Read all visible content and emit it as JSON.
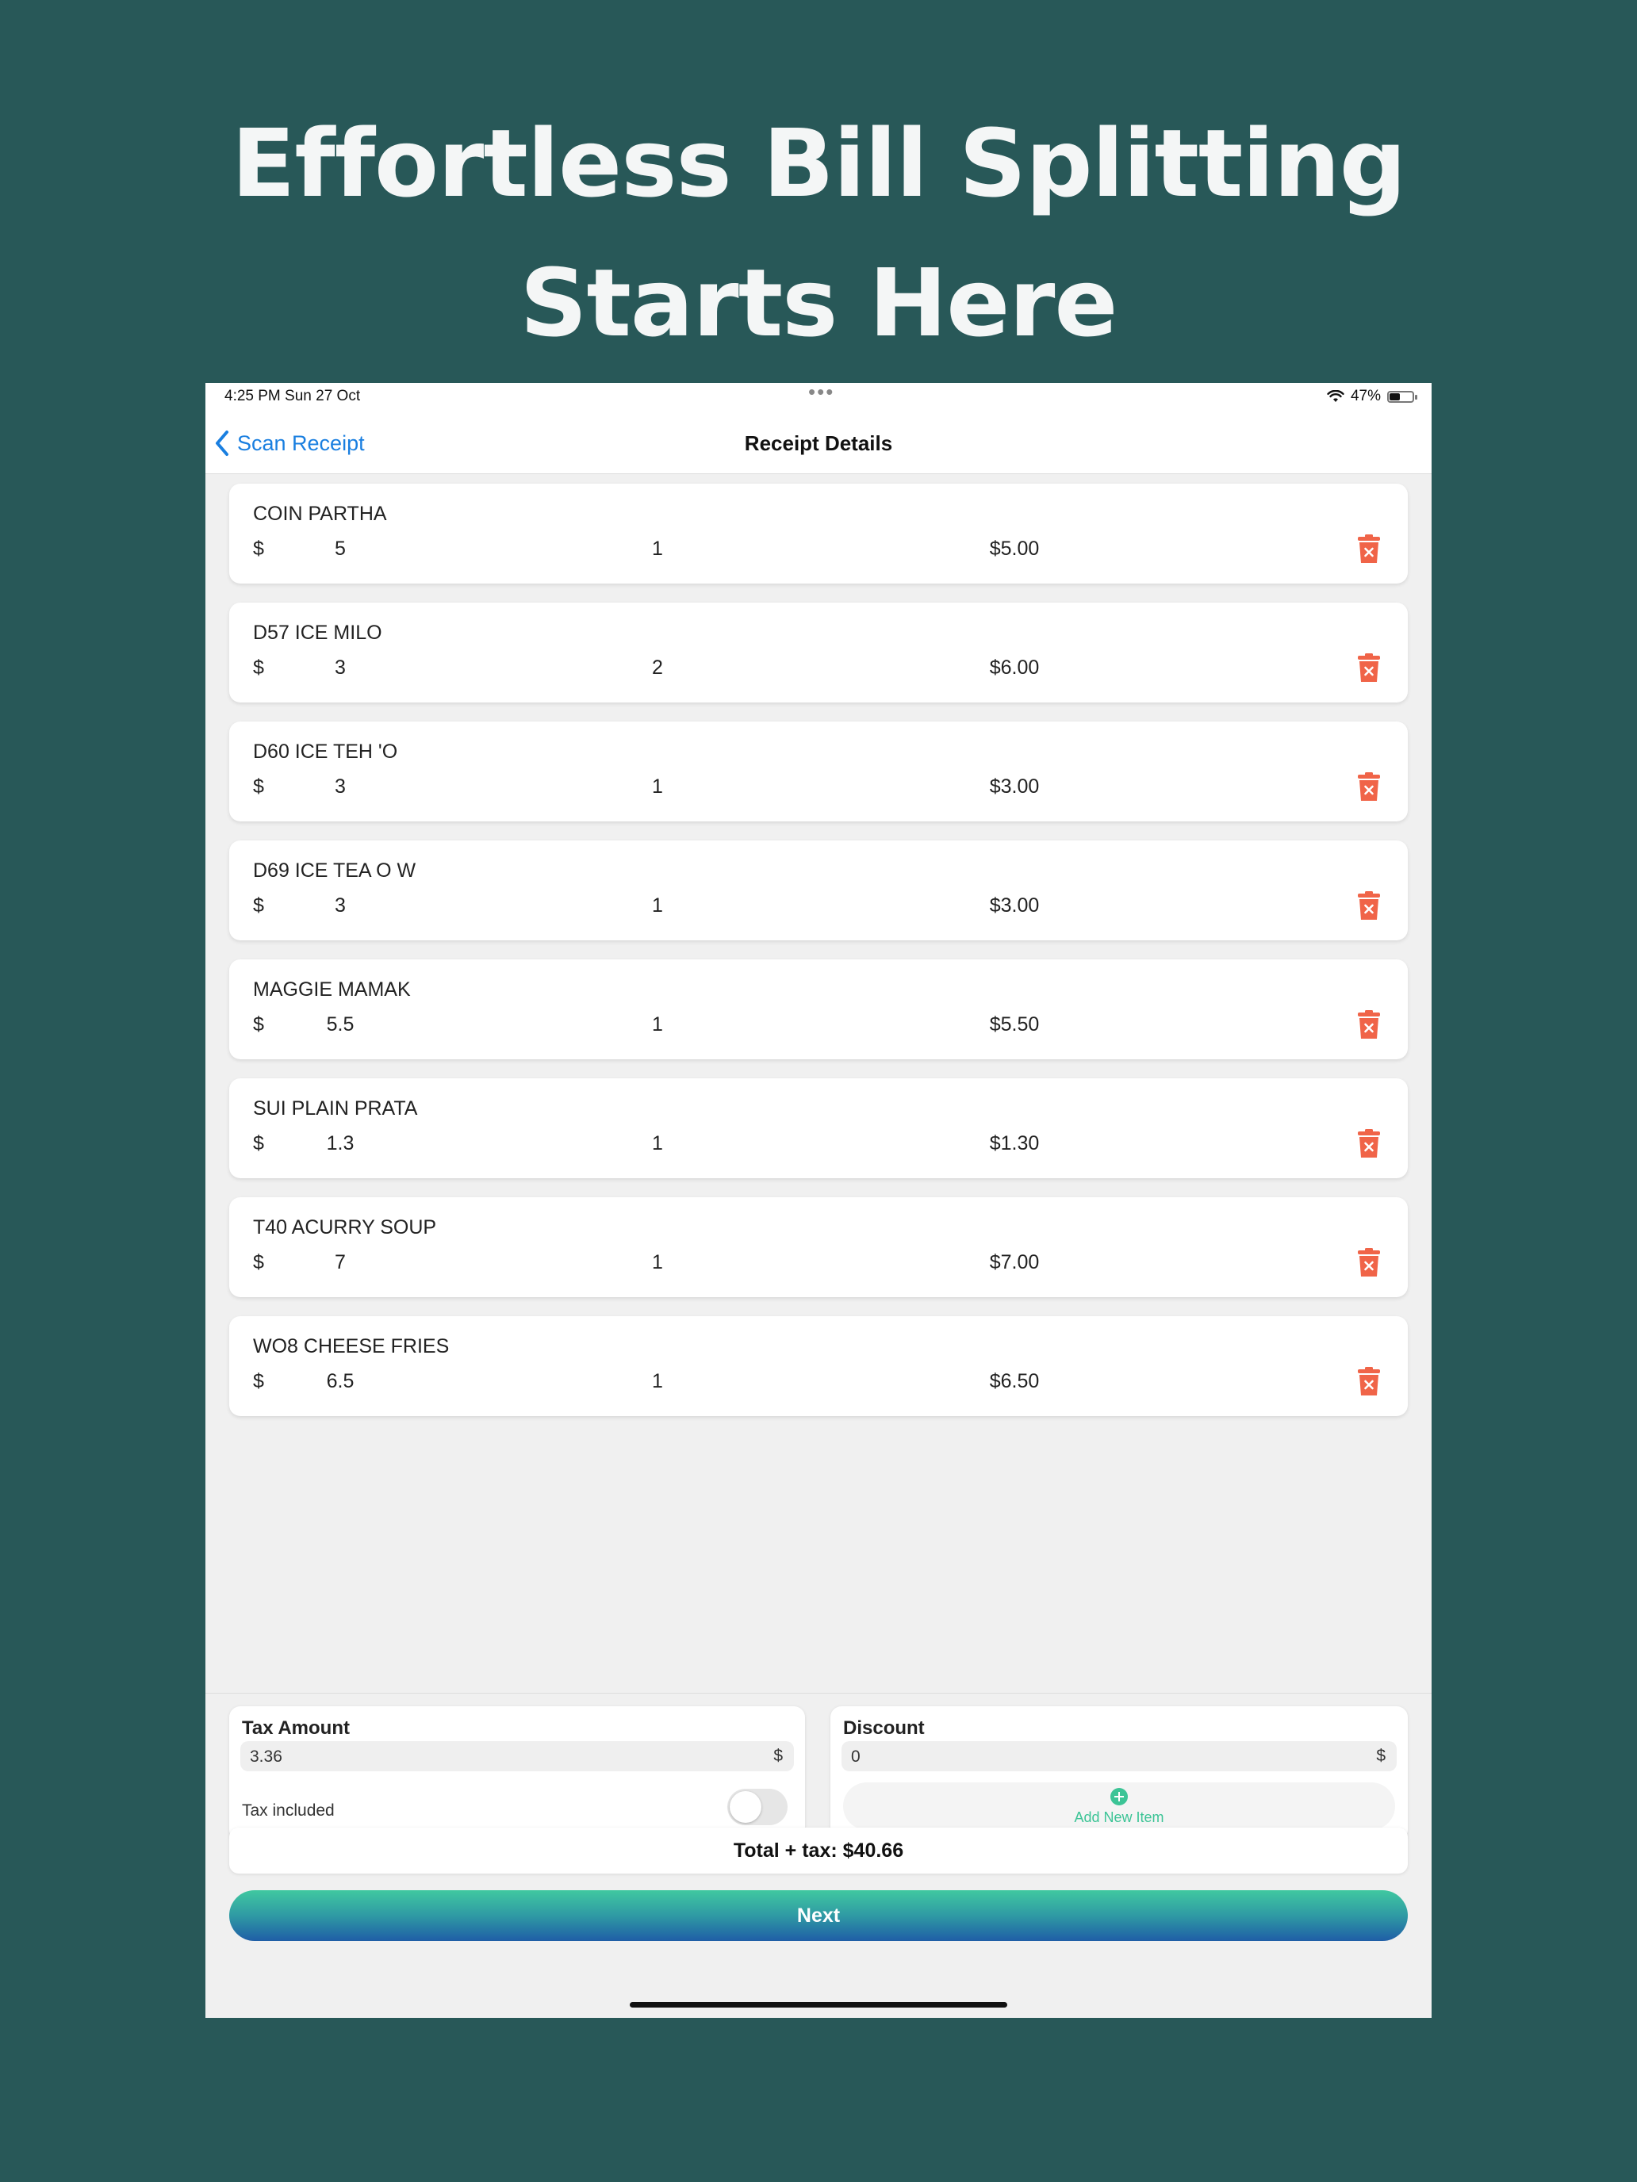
{
  "headline": {
    "line1": "Effortless Bill Splitting",
    "line2": "Starts Here"
  },
  "status_bar": {
    "time": "4:25 PM   Sun 27 Oct",
    "dots": "•••",
    "battery": "47%",
    "battery_level": 0.47
  },
  "nav": {
    "back_label": "Scan Receipt",
    "title": "Receipt Details"
  },
  "currency_symbol": "$",
  "items": [
    {
      "name": "COIN PARTHA",
      "price": "5",
      "qty": "1",
      "total": "$5.00"
    },
    {
      "name": "D57 ICE MILO",
      "price": "3",
      "qty": "2",
      "total": "$6.00"
    },
    {
      "name": "D60 ICE TEH 'O",
      "price": "3",
      "qty": "1",
      "total": "$3.00"
    },
    {
      "name": "D69 ICE TEA O W",
      "price": "3",
      "qty": "1",
      "total": "$3.00"
    },
    {
      "name": "MAGGIE MAMAK",
      "price": "5.5",
      "qty": "1",
      "total": "$5.50"
    },
    {
      "name": "SUI PLAIN PRATA",
      "price": "1.3",
      "qty": "1",
      "total": "$1.30"
    },
    {
      "name": "T40 ACURRY SOUP",
      "price": "7",
      "qty": "1",
      "total": "$7.00"
    },
    {
      "name": "WO8 CHEESE FRIES",
      "price": "6.5",
      "qty": "1",
      "total": "$6.50"
    }
  ],
  "tax": {
    "label": "Tax Amount",
    "value": "3.36",
    "suffix": "$",
    "toggle_label": "Tax included",
    "toggle_on": false
  },
  "discount": {
    "label": "Discount",
    "value": "0",
    "suffix": "$",
    "add_item_label": "Add New Item"
  },
  "total_text": "Total + tax: $40.66",
  "next_label": "Next",
  "colors": {
    "background": "#285858",
    "accent_blue": "#1a7fe0",
    "delete_red": "#f06448",
    "add_green": "#3cc496",
    "gradient_top": "#40c8a0",
    "gradient_bottom": "#1f5ea6"
  }
}
